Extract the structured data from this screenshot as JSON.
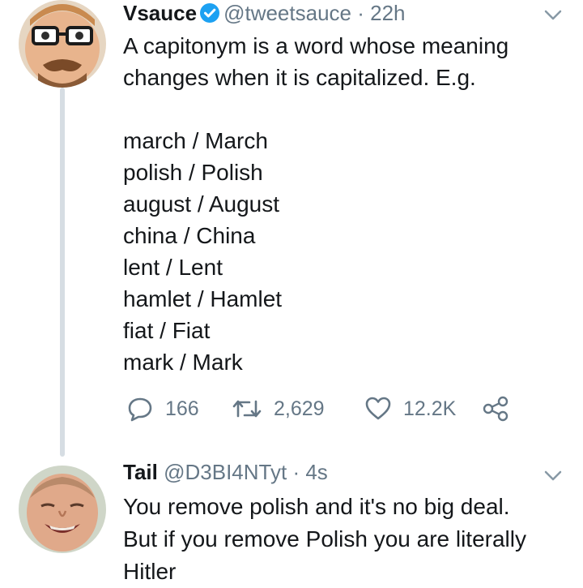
{
  "tweets": [
    {
      "name": "Vsauce",
      "handle": "@tweetsauce",
      "separator": "·",
      "time": "22h",
      "verified": true,
      "lines": [
        "A capitonym is a word whose meaning",
        "changes when it is capitalized. E.g.",
        "",
        "march / March",
        "polish / Polish",
        "august / August",
        "china / China",
        "lent / Lent",
        "hamlet / Hamlet",
        "fiat / Fiat",
        "mark / Mark"
      ],
      "actions": {
        "replies": "166",
        "retweets": "2,629",
        "likes": "12.2K"
      }
    },
    {
      "name": "Tail",
      "handle": "@D3BI4NTyt",
      "separator": "·",
      "time": "4s",
      "lines": [
        "You remove polish and it's no big deal.",
        "But if you remove Polish you are literally",
        "Hitler"
      ]
    }
  ],
  "colors": {
    "text": "#14171a",
    "muted": "#657786",
    "verified": "#1da1f2",
    "thread_line": "#d6dde3"
  },
  "icons": {
    "verified": "verified-badge-icon",
    "caret": "chevron-down-icon",
    "reply": "reply-icon",
    "retweet": "retweet-icon",
    "like": "heart-icon",
    "share": "share-icon"
  }
}
